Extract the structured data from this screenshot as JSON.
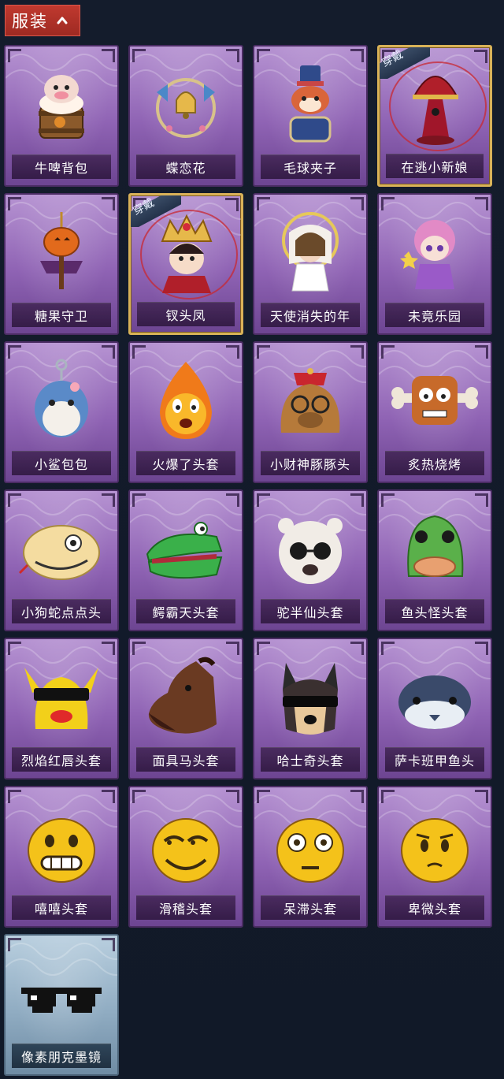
{
  "section": {
    "title": "服装",
    "expanded_icon": "chevron-up-icon"
  },
  "items": [
    {
      "name": "牛啤背包",
      "icon": "cow-beer-barrel-icon",
      "rarity_color": "#9a6ec0",
      "equipped": false
    },
    {
      "name": "蝶恋花",
      "icon": "butterfly-bell-wreath-icon",
      "rarity_color": "#9a6ec0",
      "equipped": false
    },
    {
      "name": "毛球夹子",
      "icon": "raccoon-drummer-icon",
      "rarity_color": "#9a6ec0",
      "equipped": false
    },
    {
      "name": "在逃小新娘",
      "icon": "red-bride-lamp-icon",
      "rarity_color": "#9a6ec0",
      "equipped": true,
      "tag": "穿戴"
    },
    {
      "name": "糖果守卫",
      "icon": "pumpkin-scarecrow-icon",
      "rarity_color": "#9a6ec0",
      "equipped": false
    },
    {
      "name": "钗头凤",
      "icon": "phoenix-crown-doll-icon",
      "rarity_color": "#9a6ec0",
      "equipped": true,
      "tag": "穿戴"
    },
    {
      "name": "天使消失的年",
      "icon": "angel-halo-doll-icon",
      "rarity_color": "#9a6ec0",
      "equipped": false
    },
    {
      "name": "未竟乐园",
      "icon": "pink-hair-doll-icon",
      "rarity_color": "#9a6ec0",
      "equipped": false
    },
    {
      "name": "小鲨包包",
      "icon": "shark-keychain-icon",
      "rarity_color": "#9a6ec0",
      "equipped": false
    },
    {
      "name": "火爆了头套",
      "icon": "fire-blob-mask-icon",
      "rarity_color": "#9a6ec0",
      "equipped": false
    },
    {
      "name": "小财神豚豚头",
      "icon": "capybara-god-mask-icon",
      "rarity_color": "#9a6ec0",
      "equipped": false
    },
    {
      "name": "炙热烧烤",
      "icon": "meat-bone-mask-icon",
      "rarity_color": "#9a6ec0",
      "equipped": false
    },
    {
      "name": "小狗蛇点点头",
      "icon": "snake-dog-mask-icon",
      "rarity_color": "#9a6ec0",
      "equipped": false
    },
    {
      "name": "鳄霸天头套",
      "icon": "crocodile-mask-icon",
      "rarity_color": "#9a6ec0",
      "equipped": false
    },
    {
      "name": "驼半仙头套",
      "icon": "alpaca-sunglasses-mask-icon",
      "rarity_color": "#9a6ec0",
      "equipped": false
    },
    {
      "name": "鱼头怪头套",
      "icon": "fish-head-mask-icon",
      "rarity_color": "#9a6ec0",
      "equipped": false
    },
    {
      "name": "烈焰红唇头套",
      "icon": "yellow-pika-lips-mask-icon",
      "rarity_color": "#9a6ec0",
      "equipped": false
    },
    {
      "name": "面具马头套",
      "icon": "horse-head-mask-icon",
      "rarity_color": "#9a6ec0",
      "equipped": false
    },
    {
      "name": "哈士奇头套",
      "icon": "husky-sunglasses-mask-icon",
      "rarity_color": "#9a6ec0",
      "equipped": false
    },
    {
      "name": "萨卡班甲鱼头",
      "icon": "sacabambaspis-mask-icon",
      "rarity_color": "#9a6ec0",
      "equipped": false
    },
    {
      "name": "嘻嘻头套",
      "icon": "grin-emoji-mask-icon",
      "rarity_color": "#9a6ec0",
      "equipped": false
    },
    {
      "name": "滑稽头套",
      "icon": "smirk-emoji-mask-icon",
      "rarity_color": "#9a6ec0",
      "equipped": false
    },
    {
      "name": "呆滞头套",
      "icon": "stare-emoji-mask-icon",
      "rarity_color": "#9a6ec0",
      "equipped": false
    },
    {
      "name": "卑微头套",
      "icon": "shy-emoji-mask-icon",
      "rarity_color": "#9a6ec0",
      "equipped": false
    },
    {
      "name": "像素朋克墨镜",
      "icon": "pixel-sunglasses-icon",
      "rarity_color": "#8ea9c0",
      "equipped": false
    }
  ]
}
